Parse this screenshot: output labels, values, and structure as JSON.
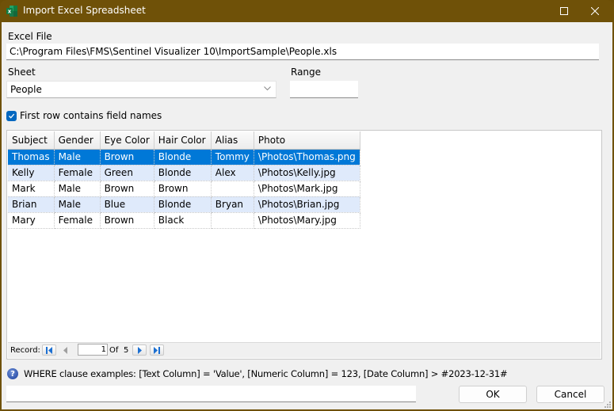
{
  "window": {
    "title": "Import Excel Spreadsheet",
    "icon": "excel-icon",
    "controls": {
      "maximize_icon": "maximize-icon",
      "close_icon": "close-icon"
    },
    "titlebar_color": "#6f5108"
  },
  "excel_file": {
    "label": "Excel File",
    "value": "C:\\Program Files\\FMS\\Sentinel Visualizer 10\\ImportSample\\People.xls"
  },
  "sheet": {
    "label": "Sheet",
    "selected": "People",
    "icon": "chevron-down-icon"
  },
  "range": {
    "label": "Range",
    "value": ""
  },
  "first_row_checkbox": {
    "label": "First row contains field names",
    "checked": true
  },
  "grid": {
    "columns": [
      "Subject",
      "Gender",
      "Eye Color",
      "Hair Color",
      "Alias",
      "Photo"
    ],
    "rows": [
      [
        "Thomas",
        "Male",
        "Brown",
        "Blonde",
        "Tommy",
        "\\Photos\\Thomas.png"
      ],
      [
        "Kelly",
        "Female",
        "Green",
        "Blonde",
        "Alex",
        "\\Photos\\Kelly.jpg"
      ],
      [
        "Mark",
        "Male",
        "Brown",
        "Brown",
        "",
        "\\Photos\\Mark.jpg"
      ],
      [
        "Brian",
        "Male",
        "Blue",
        "Blonde",
        "Bryan",
        "\\Photos\\Brian.jpg"
      ],
      [
        "Mary",
        "Female",
        "Brown",
        "Black",
        "",
        "\\Photos\\Mary.jpg"
      ]
    ],
    "selected_row": 0,
    "selection_color": "#0078d7",
    "alt_row_color": "#dfeafb"
  },
  "navigator": {
    "label": "Record:",
    "current": "1",
    "of_label": "Of",
    "total": "5",
    "icons": [
      "first-record-icon",
      "previous-record-icon",
      "next-record-icon",
      "last-record-icon"
    ]
  },
  "where": {
    "help_icon": "help-icon",
    "hint": "WHERE clause examples: [Text Column] = 'Value', [Numeric Column] = 123, [Date Column] > #2023-12-31#",
    "value": ""
  },
  "buttons": {
    "ok": "OK",
    "cancel": "Cancel"
  }
}
